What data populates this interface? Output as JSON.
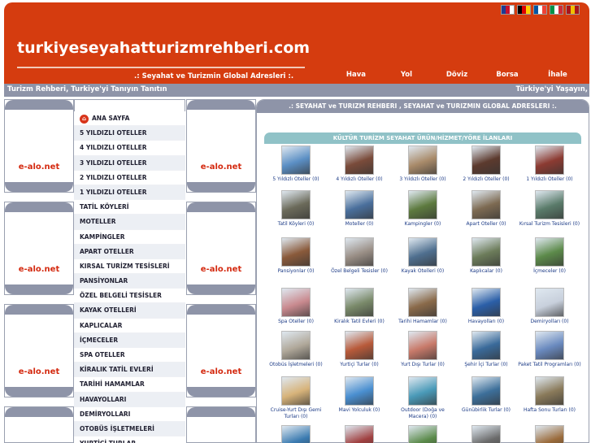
{
  "header": {
    "site_title": "turkiyeseyahatturizmrehberi.com",
    "tagline": ".: Seyahat ve Turizmin Global Adresleri :.",
    "nav": [
      {
        "label": "Hava"
      },
      {
        "label": "Yol"
      },
      {
        "label": "Döviz"
      },
      {
        "label": "Borsa"
      },
      {
        "label": "İhale"
      }
    ],
    "flags": [
      {
        "name": "flag-english-icon",
        "colors": [
          "#1f3a93",
          "#c8102e",
          "#ffffff"
        ]
      },
      {
        "name": "flag-german-icon",
        "colors": [
          "#000000",
          "#dd0000",
          "#ffce00"
        ]
      },
      {
        "name": "flag-french-icon",
        "colors": [
          "#0055a4",
          "#ffffff",
          "#ef4135"
        ]
      },
      {
        "name": "flag-italian-icon",
        "colors": [
          "#009246",
          "#ffffff",
          "#ce2b37"
        ]
      },
      {
        "name": "flag-spanish-icon",
        "colors": [
          "#aa151b",
          "#f1bf00",
          "#aa151b"
        ]
      }
    ]
  },
  "infobar": {
    "left": "Turizm Rehberi, Turkiye'yi Tanıyın Tanıtın",
    "right": "Türkiye'yi Yaşayın,"
  },
  "ads": {
    "label": "e-alo.net"
  },
  "menu": [
    {
      "label": "ANA SAYFA",
      "home": true
    },
    {
      "label": "5 YILDIZLI OTELLER"
    },
    {
      "label": "4 YILDIZLI OTELLER"
    },
    {
      "label": "3 YILDIZLI OTELLER"
    },
    {
      "label": "2 YILDIZLI OTELLER"
    },
    {
      "label": "1 YILDIZLI OTELLER"
    },
    {
      "label": "TATİL KÖYLERİ"
    },
    {
      "label": "MOTELLER"
    },
    {
      "label": "KAMPİNGLER"
    },
    {
      "label": "APART OTELLER"
    },
    {
      "label": "KIRSAL TURİZM TESİSLERİ"
    },
    {
      "label": "PANSİYONLAR"
    },
    {
      "label": "ÖZEL BELGELİ TESİSLER"
    },
    {
      "label": "KAYAK OTELLERİ"
    },
    {
      "label": "KAPLICALAR"
    },
    {
      "label": "İÇMECELER"
    },
    {
      "label": "SPA OTELLER"
    },
    {
      "label": "KİRALIK TATİL EVLERİ"
    },
    {
      "label": "TARİHİ HAMAMLAR"
    },
    {
      "label": "HAVAYOLLARI"
    },
    {
      "label": "DEMİRYOLLARI"
    },
    {
      "label": "OTOBÜS İŞLETMELERİ"
    },
    {
      "label": "YURTİÇİ TURLAR"
    }
  ],
  "main": {
    "header": ".: SEYAHAT ve TURIZM REHBERI , SEYAHAT ve TURIZMIN GLOBAL ADRESLERI :.",
    "section": "KÜLTÜR TURİZM SEYAHAT ÜRÜN/HİZMET/YÖRE İLANLARI",
    "items": [
      {
        "label": "5 Yıldızlı Oteller (0)",
        "color": "#5b8fc4"
      },
      {
        "label": "4 Yıldızlı Oteller (0)",
        "color": "#7a4b3a"
      },
      {
        "label": "3 Yıldızlı Oteller (0)",
        "color": "#a98b6a"
      },
      {
        "label": "2 Yıldızlı Oteller (0)",
        "color": "#5c3a2e"
      },
      {
        "label": "1 Yıldızlı Oteller (0)",
        "color": "#8c3b32"
      },
      {
        "label": "Tatil Köyleri (0)",
        "color": "#6b6a5a"
      },
      {
        "label": "Moteller (0)",
        "color": "#4a6f9c"
      },
      {
        "label": "Kampingler (0)",
        "color": "#5d7a3f"
      },
      {
        "label": "Apart Oteller (0)",
        "color": "#7d6a52"
      },
      {
        "label": "Kırsal Turizm Tesisleri (0)",
        "color": "#5a7b6a"
      },
      {
        "label": "Pansiyonlar (0)",
        "color": "#8a5a3b"
      },
      {
        "label": "Özel Belgeli Tesisler (0)",
        "color": "#9a8f86"
      },
      {
        "label": "Kayak Otelleri (0)",
        "color": "#4f6f8f"
      },
      {
        "label": "Kaplıcalar (0)",
        "color": "#6c7c5a"
      },
      {
        "label": "İçmeceler (0)",
        "color": "#5c8a4a"
      },
      {
        "label": "Spa Oteller (0)",
        "color": "#c98a8f"
      },
      {
        "label": "Kiralık Tatil Evleri (0)",
        "color": "#7a8a6a"
      },
      {
        "label": "Tarihi Hamamlar (0)",
        "color": "#8a6a4a"
      },
      {
        "label": "Havayolları (0)",
        "color": "#2b5fa8"
      },
      {
        "label": "Demiryolları (0)",
        "color": "#c8d0dc"
      },
      {
        "label": "Otobüs İşletmeleri (0)",
        "color": "#b0a89a"
      },
      {
        "label": "Yurtiçi Turlar (0)",
        "color": "#b85a3a"
      },
      {
        "label": "Yurt Dışı Turlar (0)",
        "color": "#c87a6a"
      },
      {
        "label": "Şehir İçi Turlar (0)",
        "color": "#3a6a9a"
      },
      {
        "label": "Paket Tatil Programları (0)",
        "color": "#6a8abf"
      },
      {
        "label": "Cruise-Yurt Dışı Gemi Turları (0)",
        "color": "#d7b37a"
      },
      {
        "label": "Mavi Yolculuk (0)",
        "color": "#4a8fd0"
      },
      {
        "label": "Outdoor (Doğa ve Macera) (0)",
        "color": "#4a9ab8"
      },
      {
        "label": "Günübirlik Turlar (0)",
        "color": "#3d6f9a"
      },
      {
        "label": "Hafta Sonu Turları (0)",
        "color": "#8a7a5a"
      },
      {
        "label": "",
        "color": "#3a7ab0"
      },
      {
        "label": "",
        "color": "#a04040"
      },
      {
        "label": "",
        "color": "#5a8a4a"
      },
      {
        "label": "",
        "color": "#6a6a6a"
      },
      {
        "label": "",
        "color": "#9a6a3a"
      }
    ]
  }
}
